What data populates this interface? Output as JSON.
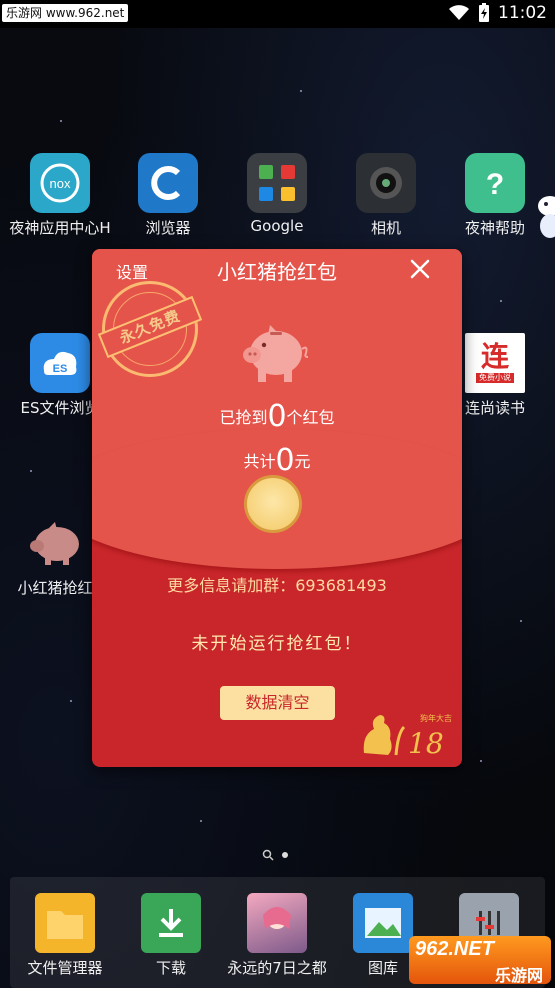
{
  "status_bar": {
    "watermark": "乐游网 www.962.net",
    "time": "11:02"
  },
  "home_apps": [
    {
      "label": "夜神应用中心H",
      "icon": "nox-icon"
    },
    {
      "label": "浏览器",
      "icon": "browser-icon"
    },
    {
      "label": "Google",
      "icon": "google-folder-icon"
    },
    {
      "label": "相机",
      "icon": "camera-icon"
    },
    {
      "label": "夜神帮助",
      "icon": "help-icon"
    },
    {
      "label": "ES文件浏览",
      "icon": "es-file-icon"
    },
    {
      "label": "连尚读书",
      "icon": "reading-icon",
      "badge": "连",
      "sub": "免费小说"
    },
    {
      "label": "小红猪抢红",
      "icon": "pig-icon"
    }
  ],
  "dialog": {
    "settings": "设置",
    "title": "小红猪抢红包",
    "stamp_text": "永久免费",
    "grabbed_prefix": "已抢到",
    "grabbed_count": "0",
    "grabbed_suffix": "个红包",
    "total_prefix": "共计",
    "total_amount": "0",
    "total_suffix": "元",
    "group_info": "更多信息请加群：693681493",
    "status_message": "未开始运行抢红包！",
    "clear_button": "数据清空",
    "logo_caption": "狗年大吉",
    "logo_number": "18"
  },
  "dock_apps": [
    {
      "label": "文件管理器",
      "icon": "folder-icon"
    },
    {
      "label": "下载",
      "icon": "download-icon"
    },
    {
      "label": "永远的7日之都",
      "icon": "game-icon"
    },
    {
      "label": "图库",
      "icon": "gallery-icon"
    },
    {
      "label": "",
      "icon": "settings-icon"
    }
  ],
  "brand_badge": {
    "line1": "962.NET",
    "line2": "乐游网"
  },
  "colors": {
    "dialog_red": "#c8262a",
    "dialog_top": "#e5544a",
    "gold": "#fbe0a2",
    "pig_pink": "#f4a6a0"
  }
}
